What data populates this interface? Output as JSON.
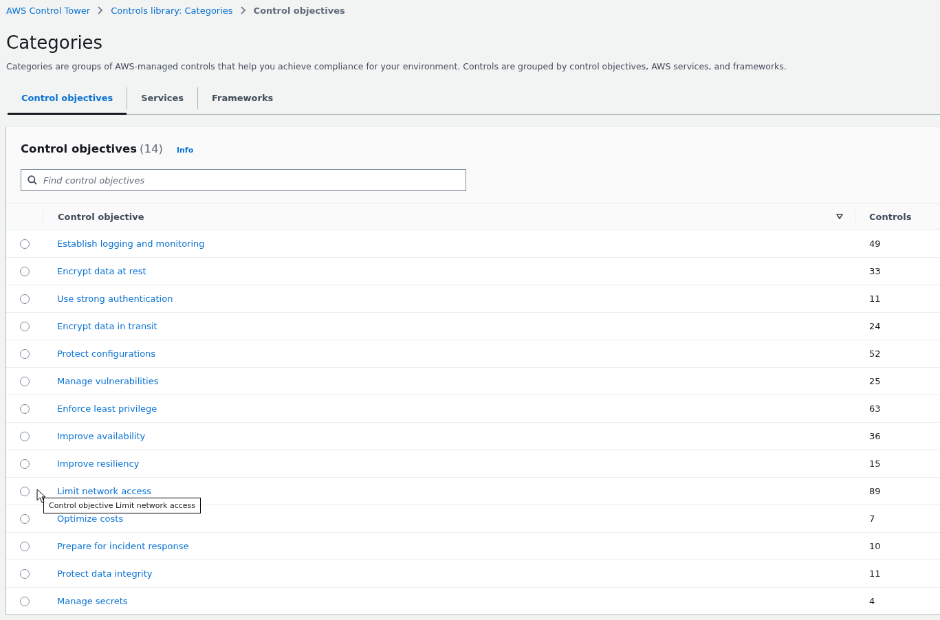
{
  "breadcrumbs": [
    {
      "label": "AWS Control Tower",
      "current": false
    },
    {
      "label": "Controls library: Categories",
      "current": false
    },
    {
      "label": "Control objectives",
      "current": true
    }
  ],
  "page": {
    "title": "Categories",
    "description": "Categories are groups of AWS-managed controls that help you achieve compliance for your environment. Controls are grouped by control objectives, AWS services, and frameworks."
  },
  "tabs": [
    {
      "label": "Control objectives",
      "selected": true
    },
    {
      "label": "Services",
      "selected": false
    },
    {
      "label": "Frameworks",
      "selected": false
    }
  ],
  "panel": {
    "title": "Control objectives",
    "count": "(14)",
    "info": "Info"
  },
  "search": {
    "placeholder": "Find control objectives"
  },
  "table": {
    "columns": [
      "Control objective",
      "Controls"
    ],
    "rows": [
      {
        "name": "Establish logging and monitoring",
        "controls": "49",
        "selected": false
      },
      {
        "name": "Encrypt data at rest",
        "controls": "33",
        "selected": false
      },
      {
        "name": "Use strong authentication",
        "controls": "11",
        "selected": false
      },
      {
        "name": "Encrypt data in transit",
        "controls": "24",
        "selected": false
      },
      {
        "name": "Protect configurations",
        "controls": "52",
        "selected": false
      },
      {
        "name": "Manage vulnerabilities",
        "controls": "25",
        "selected": false
      },
      {
        "name": "Enforce least privilege",
        "controls": "63",
        "selected": false
      },
      {
        "name": "Improve availability",
        "controls": "36",
        "selected": false
      },
      {
        "name": "Improve resiliency",
        "controls": "15",
        "selected": false
      },
      {
        "name": "Limit network access",
        "controls": "89",
        "selected": false
      },
      {
        "name": "Optimize costs",
        "controls": "7",
        "selected": false
      },
      {
        "name": "Prepare for incident response",
        "controls": "10",
        "selected": false
      },
      {
        "name": "Protect data integrity",
        "controls": "11",
        "selected": false
      },
      {
        "name": "Manage secrets",
        "controls": "4",
        "selected": false
      }
    ]
  },
  "tooltip": {
    "text": "Control objective Limit network access"
  }
}
